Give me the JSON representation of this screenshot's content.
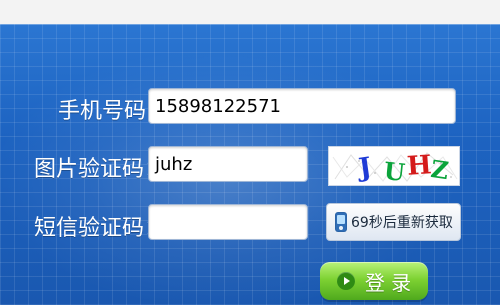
{
  "form": {
    "phone": {
      "label": "手机号码：",
      "value": "15898122571"
    },
    "image_code": {
      "label": "图片验证码：",
      "value": "juhz"
    },
    "captcha": {
      "chars": [
        {
          "text": "J",
          "color": "#1f3bd6"
        },
        {
          "text": "U",
          "color": "#0aa33a"
        },
        {
          "text": "H",
          "color": "#d41b1b"
        },
        {
          "text": "Z",
          "color": "#0aa33a"
        }
      ]
    },
    "sms_code": {
      "label": "短信验证码：",
      "value": ""
    },
    "sms_button": {
      "label": "69秒后重新获取",
      "icon": "phone-icon"
    },
    "login_button": {
      "label": "登 录",
      "icon": "arrow-circle-icon"
    }
  }
}
